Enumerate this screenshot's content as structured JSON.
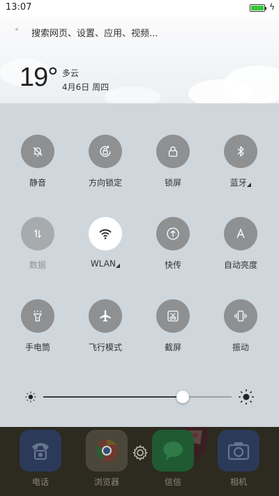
{
  "status_bar": {
    "time": "13:07",
    "battery_level": 1.0,
    "battery_color": "#37c837"
  },
  "search": {
    "placeholder": "搜索网页、设置、应用、视频..."
  },
  "weather": {
    "temperature": "19°",
    "condition": "多云",
    "date": "4月6日 周四"
  },
  "quick_settings": {
    "row1": [
      {
        "label": "静音",
        "icon": "bell-off-icon",
        "state": "off"
      },
      {
        "label": "方向锁定",
        "icon": "rotation-lock-icon",
        "state": "off"
      },
      {
        "label": "锁屏",
        "icon": "lock-icon",
        "state": "off"
      },
      {
        "label": "蓝牙",
        "icon": "bluetooth-icon",
        "state": "off",
        "has_more": true
      }
    ],
    "row2": [
      {
        "label": "数据",
        "icon": "mobile-data-icon",
        "state": "disabled"
      },
      {
        "label": "WLAN",
        "icon": "wifi-icon",
        "state": "on",
        "has_more": true
      },
      {
        "label": "快传",
        "icon": "quick-transfer-icon",
        "state": "off"
      },
      {
        "label": "自动亮度",
        "icon": "auto-brightness-icon",
        "state": "off"
      }
    ],
    "row3": [
      {
        "label": "手电筒",
        "icon": "flashlight-icon",
        "state": "off"
      },
      {
        "label": "飞行模式",
        "icon": "airplane-icon",
        "state": "off"
      },
      {
        "label": "截屏",
        "icon": "screenshot-icon",
        "state": "off"
      },
      {
        "label": "振动",
        "icon": "vibrate-icon",
        "state": "off"
      }
    ],
    "caret": "◢"
  },
  "brightness": {
    "level": 0.74
  },
  "dock": [
    {
      "label": "电话",
      "icon": "phone-icon",
      "color": "#2c3a5a"
    },
    {
      "label": "浏览器",
      "icon": "browser-icon",
      "color": "#4a463a"
    },
    {
      "label": "信信",
      "icon": "message-icon",
      "color": "#1f5a33"
    },
    {
      "label": "相机",
      "icon": "camera-icon",
      "color": "#2c3a5a"
    }
  ],
  "colors": {
    "panel_bg": "#cfd6dc",
    "tile_off": "#8e9092",
    "tile_on": "#ffffff",
    "accent_green": "#37c837"
  }
}
